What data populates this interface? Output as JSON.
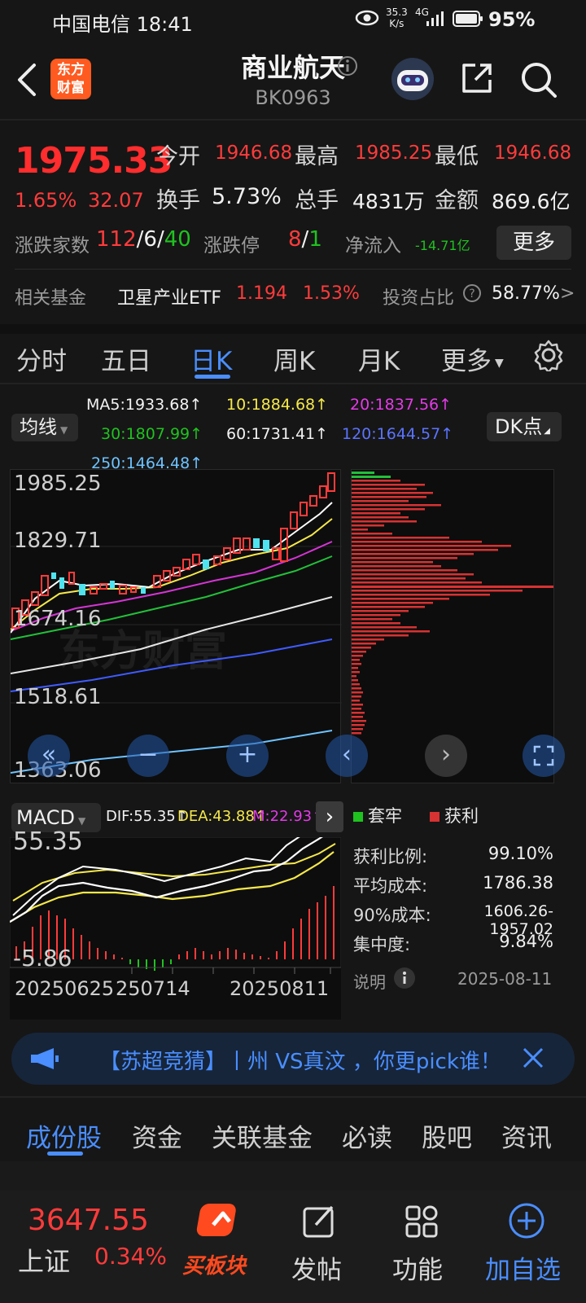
{
  "status_bar": {
    "carrier_time": "中国电信 18:41",
    "speed_value": "35.3",
    "speed_unit": "K/s",
    "network": "4G",
    "battery": "95%"
  },
  "header": {
    "logo_line1": "东方",
    "logo_line2": "财富",
    "title": "商业航天",
    "code": "BK0963"
  },
  "quote": {
    "price": "1975.33",
    "change_pct": "1.65%",
    "change_abs": "32.07",
    "open_label": "今开",
    "open_value": "1946.68",
    "high_label": "最高",
    "high_value": "1985.25",
    "low_label": "最低",
    "low_value": "1946.68",
    "turnover_label": "换手",
    "turnover_value": "5.73%",
    "volume_label": "总手",
    "volume_value": "4831万",
    "amount_label": "金额",
    "amount_value": "869.6亿",
    "updown_label": "涨跌家数",
    "up_count": "112",
    "flat_count": "6",
    "down_count": "40",
    "limit_label": "涨跌停",
    "limit_up": "8",
    "limit_down": "1",
    "netflow_label": "净流入",
    "netflow_value": "-14.71亿",
    "more_label": "更多",
    "slash": "/"
  },
  "fund": {
    "label": "相关基金",
    "name": "卫星产业ETF",
    "price": "1.194",
    "pct": "1.53%",
    "ratio_label": "投资占比",
    "ratio_value": "58.77%",
    "arrow": ">"
  },
  "chart_tabs": [
    "分时",
    "五日",
    "日K",
    "周K",
    "月K",
    "更多"
  ],
  "indicators": {
    "ma_button": "均线",
    "dk_button": "DK点",
    "ma5": "MA5:1933.68↑",
    "ma10": "10:1884.68↑",
    "ma20": "20:1837.56↑",
    "ma30": "30:1807.99↑",
    "ma60": "60:1731.41↑",
    "ma120": "120:1644.57↑",
    "ma250": "250:1464.48↑"
  },
  "kline": {
    "y_labels": [
      "1985.25",
      "1829.71",
      "1674.16",
      "1518.61",
      "1363.06"
    ],
    "watermark": "东方财富"
  },
  "macd": {
    "button": "MACD",
    "dif": "DIF:55.35↑",
    "dea": "DEA:43.88↑",
    "m": "M:22.93↑",
    "y_top": "55.35",
    "y_bottom": "-5.86",
    "dates": [
      "20250625",
      "250714",
      "20250811"
    ]
  },
  "distribution": {
    "legend_trapped": "套牢",
    "legend_profit": "获利",
    "rows": [
      {
        "label": "获利比例:",
        "value": "99.10%"
      },
      {
        "label": "平均成本:",
        "value": "1786.38"
      },
      {
        "label": "90%成本:",
        "value": "1606.26-1957.02"
      },
      {
        "label": "集中度:",
        "value": "9.84%"
      }
    ],
    "note_label": "说明",
    "date": "2025-08-11"
  },
  "ticker_text": "【苏超竞猜】丨州 VS真汶 ，你更pick谁！",
  "section_tabs": [
    "成份股",
    "资金",
    "关联基金",
    "必读",
    "股吧",
    "资讯"
  ],
  "bottom_nav": {
    "index_value": "3647.55",
    "index_name": "上证",
    "index_pct": "0.34%",
    "buy_label": "买板块",
    "post_label": "发帖",
    "func_label": "功能",
    "add_label": "加自选"
  },
  "colors": {
    "up": "#ff3b3b",
    "down": "#1fc21f",
    "accent": "#4a8eff",
    "background": "#161616"
  }
}
